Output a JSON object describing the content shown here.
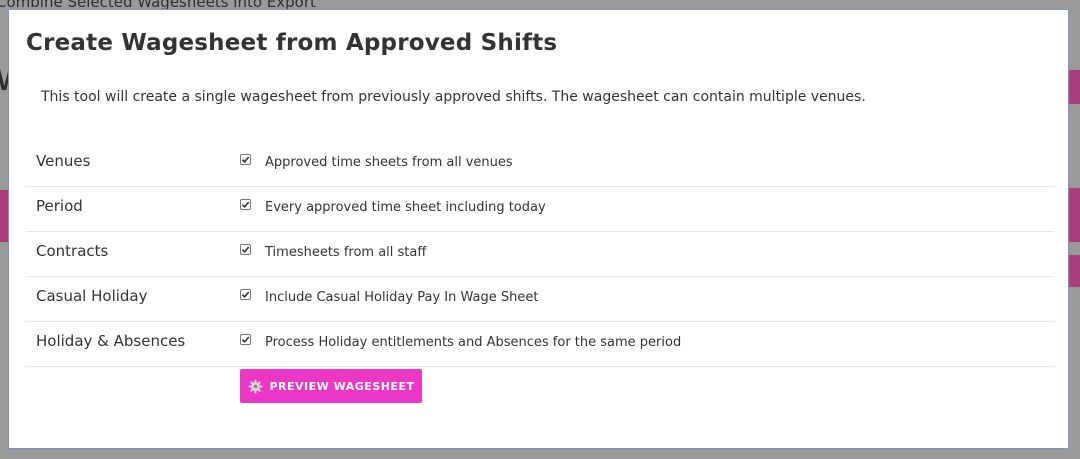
{
  "background": {
    "top_text": "Combine Selected Wagesheets into Export"
  },
  "modal": {
    "title": "Create Wagesheet from Approved Shifts",
    "intro": "This tool will create a single wagesheet from previously approved shifts. The wagesheet can contain multiple venues.",
    "rows": [
      {
        "label": "Venues",
        "checked": true,
        "text": "Approved time sheets from all venues"
      },
      {
        "label": "Period",
        "checked": true,
        "text": "Every approved time sheet including today"
      },
      {
        "label": "Contracts",
        "checked": true,
        "text": "Timesheets from all staff"
      },
      {
        "label": "Casual Holiday",
        "checked": true,
        "text": "Include Casual Holiday Pay In Wage Sheet"
      },
      {
        "label": "Holiday & Absences",
        "checked": true,
        "text": "Process Holiday entitlements and Absences for the same period"
      }
    ],
    "preview_button": {
      "label": "PREVIEW WAGESHEET",
      "icon": "gear-icon",
      "color": "#ec36c5"
    }
  },
  "colors": {
    "accent": "#ec36c5",
    "modal_border": "#7e93c2",
    "overlay": "#8c8c8c"
  }
}
